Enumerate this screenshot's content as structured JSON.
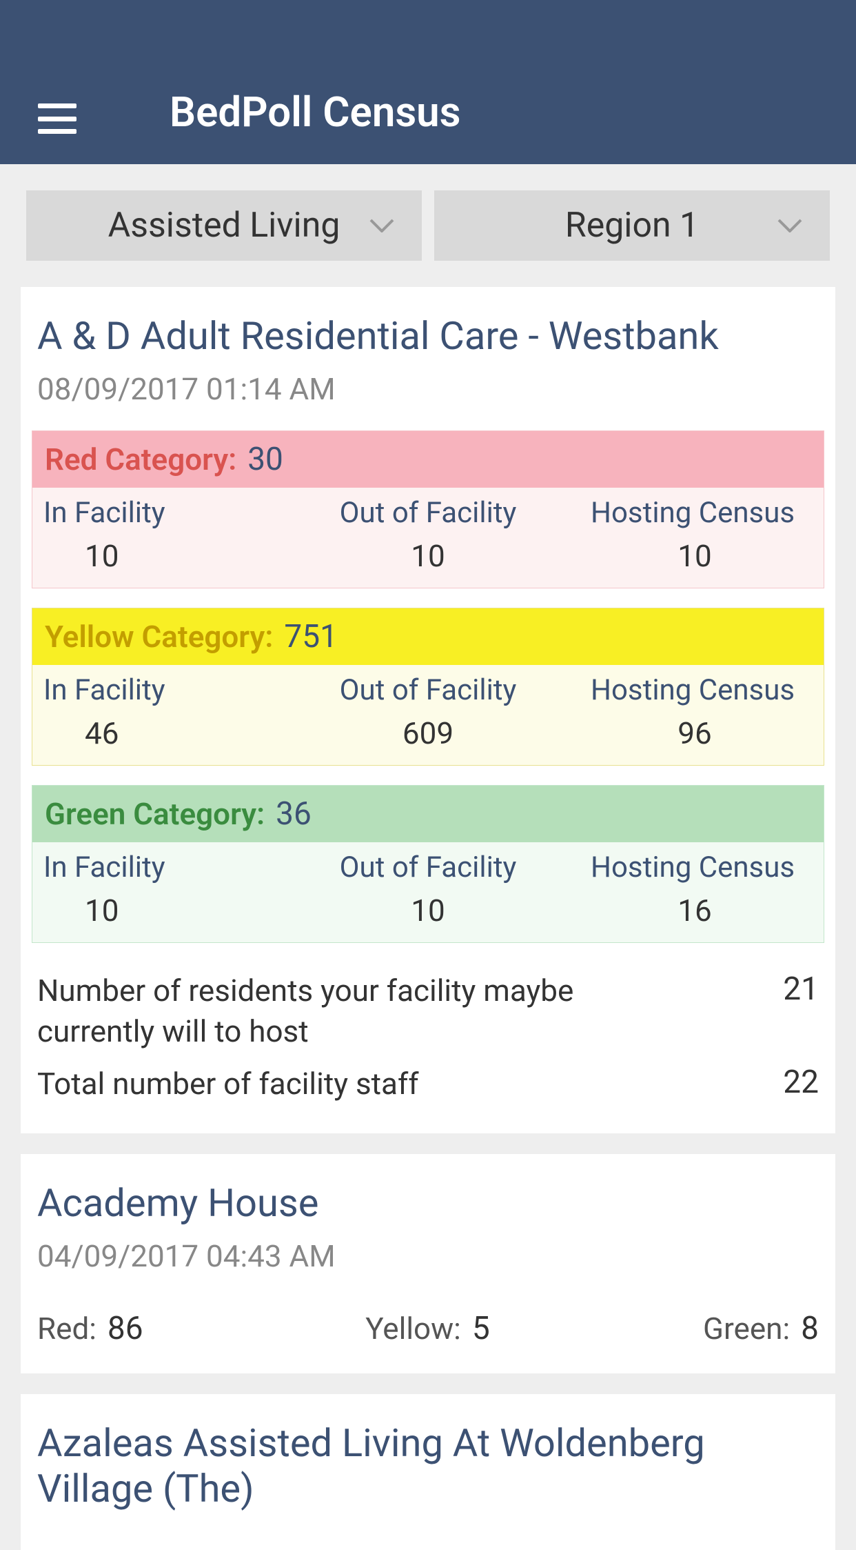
{
  "header": {
    "title": "BedPoll Census"
  },
  "filters": {
    "type": "Assisted Living",
    "region": "Region 1"
  },
  "labels": {
    "in_facility": "In Facility",
    "out_of_facility": "Out of Facility",
    "hosting_census": "Hosting Census",
    "red_category": "Red Category:",
    "yellow_category": "Yellow Category:",
    "green_category": "Green Category:",
    "willing_to_host": "Number of residents your facility maybe currently will to host",
    "total_staff": "Total number of facility staff",
    "red_short": "Red:",
    "yellow_short": "Yellow:",
    "green_short": "Green:"
  },
  "facilities": {
    "0": {
      "name": "A & D Adult Residential Care - Westbank",
      "timestamp": "08/09/2017 01:14 AM",
      "red": {
        "total": "30",
        "in_facility": "10",
        "out_of_facility": "10",
        "hosting_census": "10"
      },
      "yellow": {
        "total": "751",
        "in_facility": "46",
        "out_of_facility": "609",
        "hosting_census": "96"
      },
      "green": {
        "total": "36",
        "in_facility": "10",
        "out_of_facility": "10",
        "hosting_census": "16"
      },
      "willing_to_host": "21",
      "total_staff": "22"
    },
    "1": {
      "name": "Academy House",
      "timestamp": "04/09/2017 04:43 AM",
      "red_short": "86",
      "yellow_short": "5",
      "green_short": "8"
    },
    "2": {
      "name": "Azaleas Assisted Living At Woldenberg Village (The)"
    }
  }
}
